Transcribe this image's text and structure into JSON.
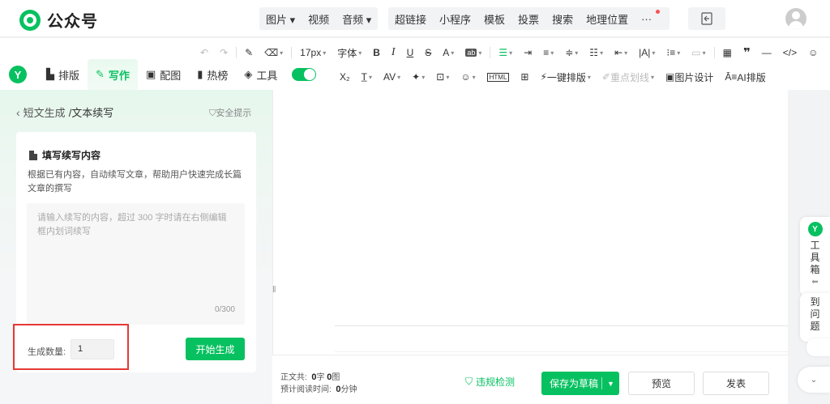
{
  "header": {
    "app_name": "公众号",
    "menu_a": [
      "图片",
      "视频",
      "音频"
    ],
    "menu_b": [
      "超链接",
      "小程序",
      "模板",
      "投票",
      "搜索",
      "地理位置",
      "···"
    ],
    "brand_color": "#07c160"
  },
  "toolbar": {
    "font_size": "17px",
    "font_family": "字体",
    "bold": "B",
    "italic": "I",
    "underline": "U",
    "strike": "S",
    "font_color": "A",
    "subscript": "X₂",
    "one_click_layout": "一键排版",
    "highlight_line": "重点划线",
    "image_design": "图片设计",
    "ai_layout": "AI排版"
  },
  "tabs": [
    {
      "label": "排版",
      "icon": "layout-icon"
    },
    {
      "label": "写作",
      "icon": "write-icon"
    },
    {
      "label": "配图",
      "icon": "image-icon"
    },
    {
      "label": "热榜",
      "icon": "bookmark-icon"
    },
    {
      "label": "工具",
      "icon": "cube-icon"
    }
  ],
  "left_panel": {
    "breadcrumb_parent": "短文生成",
    "breadcrumb_current": "/文本续写",
    "safety_tip": "安全提示",
    "card_title": "填写续写内容",
    "card_desc": "根据已有内容，自动续写文章，帮助用户快速完成长篇文章的撰写",
    "textarea_placeholder": "请输入续写的内容，超过 300 字时请在右侧编辑框内划词续写",
    "char_counter": "0/300",
    "quantity_label": "生成数量:",
    "quantity_value": "1",
    "generate_button": "开始生成"
  },
  "bottom_bar": {
    "stats_body_label": "正文共:",
    "stats_words": "0",
    "stats_words_unit": "字",
    "stats_images": "0",
    "stats_images_unit": "图",
    "read_time_label": "预计阅读时间:",
    "read_time": "0",
    "read_time_unit": "分钟",
    "violation_check": "违规检测",
    "save_draft": "保存为草稿",
    "preview": "预览",
    "publish": "发表"
  },
  "right_side": {
    "toolbox_label": "工具箱",
    "report_label": "到问题"
  }
}
